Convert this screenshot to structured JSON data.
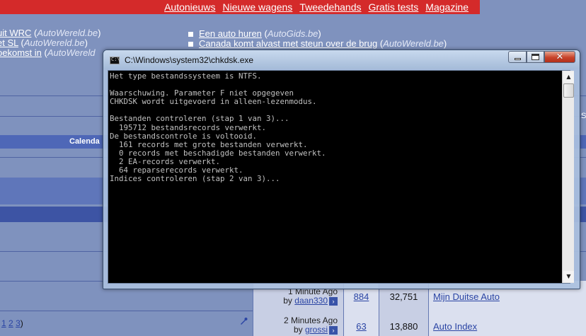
{
  "background_page": {
    "topnav": [
      "Autonieuws",
      "Nieuwe wagens",
      "Tweedehands",
      "Gratis tests",
      "Magazine"
    ],
    "news_left": [
      {
        "title": "uit WRC",
        "source": "AutoWereld.be"
      },
      {
        "title": "et SL",
        "source": "AutoWereld.be"
      },
      {
        "title": "oekomst in",
        "source": "AutoWereld"
      }
    ],
    "news_right": [
      {
        "title": "Een auto huren",
        "source": "AutoGids.be"
      },
      {
        "title": "Canada komt alvast met steun over de brug",
        "source": "AutoWereld.be"
      }
    ],
    "calendar_label": "Calenda",
    "rows": [
      {
        "last_post": "1 Minute Ago",
        "by_label": "by",
        "user": "daan330",
        "replies": "884",
        "views": "32,751",
        "forum": "Mijn Duitse Auto",
        "pages": ""
      },
      {
        "last_post": "2 Minutes Ago",
        "by_label": "by",
        "user": "grossi",
        "replies": "63",
        "views": "13,880",
        "forum": "Auto Index",
        "pages_prefix": "(",
        "pages": [
          "1",
          "2",
          "3"
        ],
        "pages_suffix": ")"
      }
    ]
  },
  "console_window": {
    "title": "C:\\Windows\\system32\\chkdsk.exe",
    "controls": {
      "minimize": "minimize",
      "maximize": "maximize",
      "close": "close"
    },
    "lines": [
      "Het type bestandssysteem is NTFS.",
      "",
      "Waarschuwing. Parameter F niet opgegeven",
      "CHKDSK wordt uitgevoerd in alleen-lezenmodus.",
      "",
      "Bestanden controleren (stap 1 van 3)...",
      "  195712 bestandsrecords verwerkt.",
      "De bestandscontrole is voltooid.",
      "  161 records met grote bestanden verwerkt.",
      "  0 records met beschadigde bestanden verwerkt.",
      "  2 EA-records verwerkt.",
      "  64 reparserecords verwerkt.",
      "Indices controleren (stap 2 van 3)..."
    ]
  },
  "colors": {
    "page_bg": "#7f92be",
    "nav_red": "#d42a2a",
    "console_bg": "#000000",
    "console_text": "#c0c0c0",
    "close_red": "#c8432a"
  }
}
